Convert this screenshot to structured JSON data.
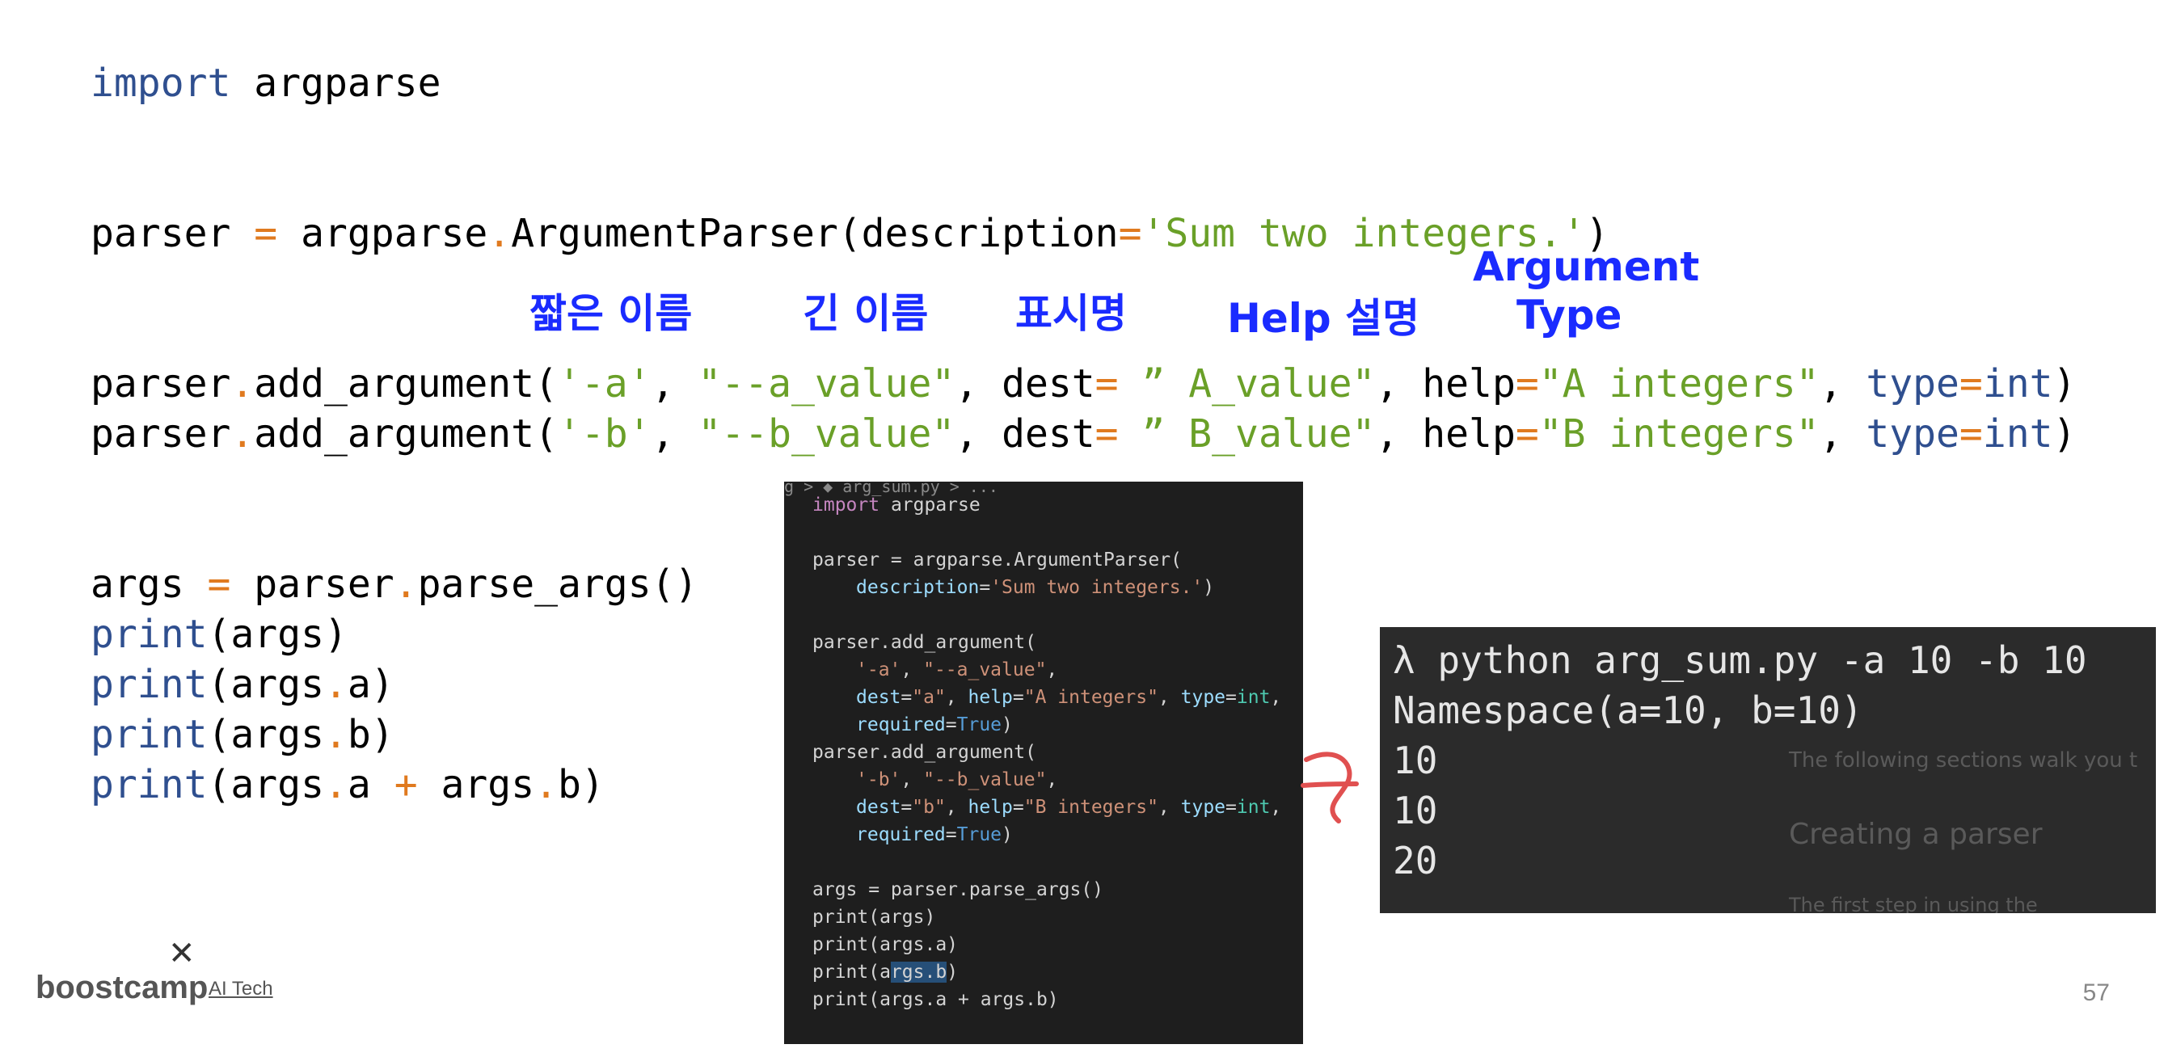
{
  "code": {
    "line1": {
      "kw": "import",
      "rest": " argparse"
    },
    "line2": {
      "a": "parser ",
      "eq": "=",
      "b": " argparse",
      "dot": ".",
      "c": "ArgumentParser(description",
      "eq2": "=",
      "s": "'Sum two integers.'",
      "d": ")"
    },
    "line3": {
      "a": "parser",
      "dot": ".",
      "b": "add_argument(",
      "s1": "'-a'",
      "c1": ", ",
      "s2": "\"--a_value\"",
      "c2": ", dest",
      "eq": "=",
      "s3": " ” A_value\"",
      "c3": ", help",
      "eq2": "=",
      "s4": "\"A integers\"",
      "c4": ", ",
      "k1": "type",
      "eq3": "=",
      "k2": "int",
      "d": ")"
    },
    "line4": {
      "a": "parser",
      "dot": ".",
      "b": "add_argument(",
      "s1": "'-b'",
      "c1": ", ",
      "s2": "\"--b_value\"",
      "c2": ", dest",
      "eq": "=",
      "s3": " ” B_value\"",
      "c3": ", help",
      "eq2": "=",
      "s4": "\"B integers\"",
      "c4": ", ",
      "k1": "type",
      "eq3": "=",
      "k2": "int",
      "d": ")"
    },
    "line5": {
      "a": "args ",
      "eq": "=",
      "b": " parser",
      "dot": ".",
      "c": "parse_args()"
    },
    "line6": {
      "k": "print",
      "r": "(args)"
    },
    "line7": {
      "k": "print",
      "a": "(args",
      "dot": ".",
      "b": "a)"
    },
    "line8": {
      "k": "print",
      "a": "(args",
      "dot": ".",
      "b": "b)"
    },
    "line9": {
      "k": "print",
      "a": "(args",
      "dot": ".",
      "b": "a ",
      "plus": "+",
      "c": " args",
      "dot2": ".",
      "d": "b)"
    }
  },
  "annotations": {
    "short_name": "짧은 이름",
    "long_name": "긴 이름",
    "display_name": "표시명",
    "help_desc": "Help 설명",
    "arg_type_1": "Argument",
    "arg_type_2": "Type"
  },
  "editor": {
    "breadcrumb": "g > ◆ arg_sum.py > ...",
    "l1_kw": "import",
    "l1_rest": " argparse",
    "l2": "parser = argparse.ArgumentParser(",
    "l3_k": "description",
    "l3_eq": "=",
    "l3_s": "'Sum two integers.'",
    "l3_d": ")",
    "l4": "parser.add_argument(",
    "l5_s1": "'-a'",
    "l5_c": ", ",
    "l5_s2": "\"--a_value\"",
    "l5_d": ",",
    "l6_k1": "dest",
    "l6_s1": "\"a\"",
    "l6_k2": "help",
    "l6_s2": "\"A integers\"",
    "l6_k3": "type",
    "l6_t": "int",
    "l6_d": ",",
    "l7_k": "required",
    "l7_v": "True",
    "l7_d": ")",
    "l8": "parser.add_argument(",
    "l9_s1": "'-b'",
    "l9_c": ", ",
    "l9_s2": "\"--b_value\"",
    "l9_d": ",",
    "l10_k1": "dest",
    "l10_s1": "\"b\"",
    "l10_k2": "help",
    "l10_s2": "\"B integers\"",
    "l10_k3": "type",
    "l10_t": "int",
    "l10_d": ",",
    "l11_k": "required",
    "l11_v": "True",
    "l11_d": ")",
    "l12": "args = parser.parse_args()",
    "l13": "print(args)",
    "l14": "print(args.a)",
    "l15_a": "print(a",
    "l15_sel": "rgs.b",
    "l15_b": ")",
    "l16": "print(args.a + args.b)"
  },
  "terminal": {
    "cmd": "λ python arg_sum.py -a 10 -b 10",
    "ns": "Namespace(a=10, b=10)",
    "out1": "10",
    "out2": "10",
    "out3": "20",
    "ghost1": "The following sections walk you t",
    "ghost2": "Creating a parser",
    "ghost3": "The first step in using the"
  },
  "footer": {
    "page_number": "57",
    "logo_main": "boostcamp",
    "logo_sub": "AI Tech",
    "logo_x": "✕"
  }
}
